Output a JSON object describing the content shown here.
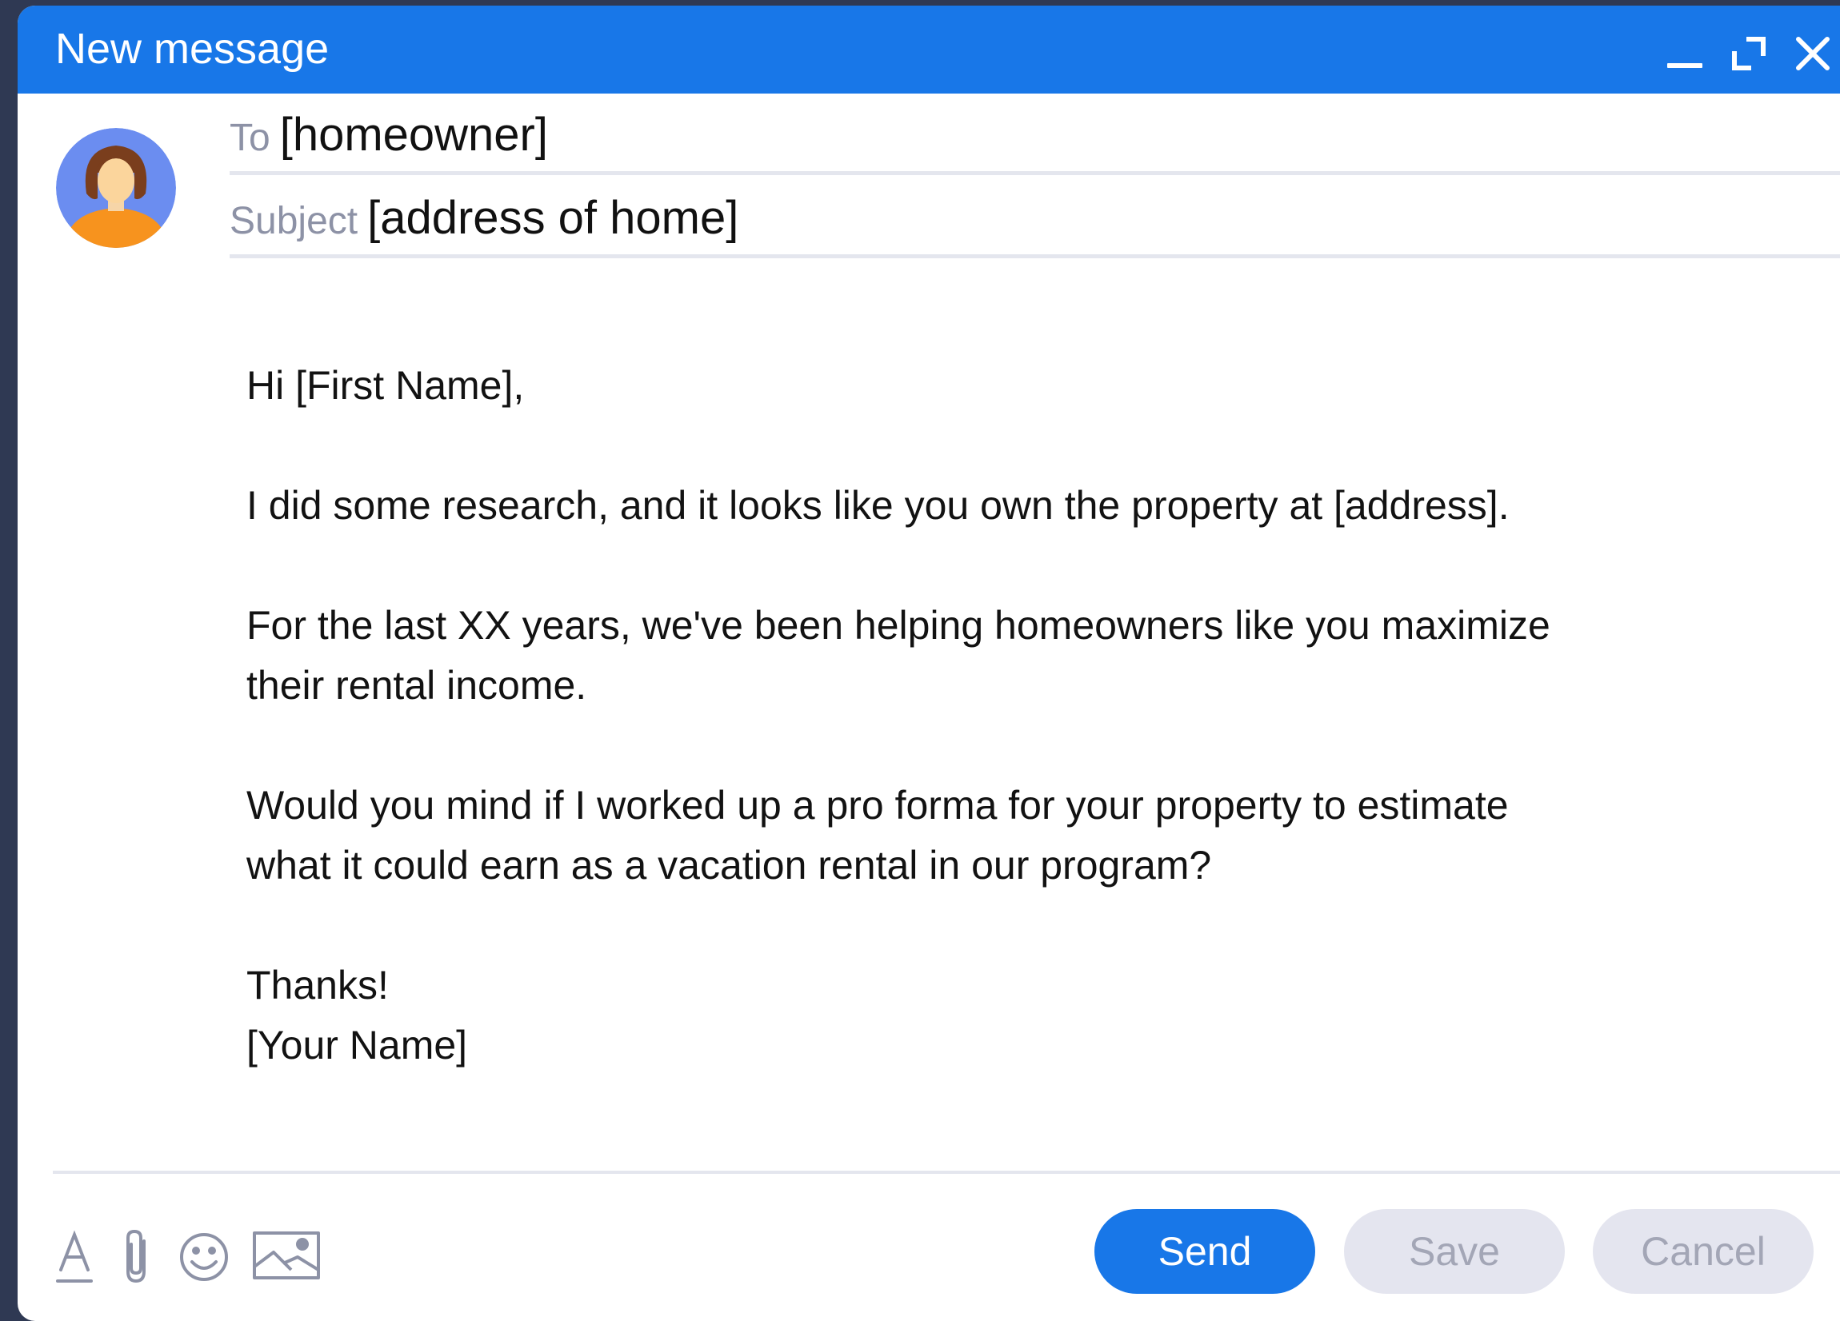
{
  "window": {
    "title": "New message",
    "controls": {
      "minimize_icon": "minimize-icon",
      "maximize_icon": "maximize-icon",
      "close_icon": "close-icon"
    }
  },
  "compose": {
    "to_label": "To",
    "to_value": "[homeowner]",
    "subject_label": "Subject",
    "subject_value": "[address of home]"
  },
  "body": {
    "greeting": "Hi [First Name],",
    "paragraph1": "I did some research, and it looks like you own the property at [address].",
    "paragraph2": "For the last XX years, we've been helping homeowners like you maximize\ntheir rental income.",
    "paragraph3": "Would you mind if I worked up a pro forma for your property to estimate\nwhat it could earn as a vacation rental in our program?",
    "signoff": "Thanks!\n[Your Name]"
  },
  "toolbar": {
    "icons": [
      "text-format-icon",
      "paperclip-icon",
      "emoji-icon",
      "image-icon"
    ]
  },
  "actions": {
    "send_label": "Send",
    "save_label": "Save",
    "cancel_label": "Cancel"
  },
  "colors": {
    "accent": "#1877e8",
    "disabled_button": "#e4e5ef",
    "disabled_text": "#a3a6b6",
    "background": "#2f3953"
  }
}
